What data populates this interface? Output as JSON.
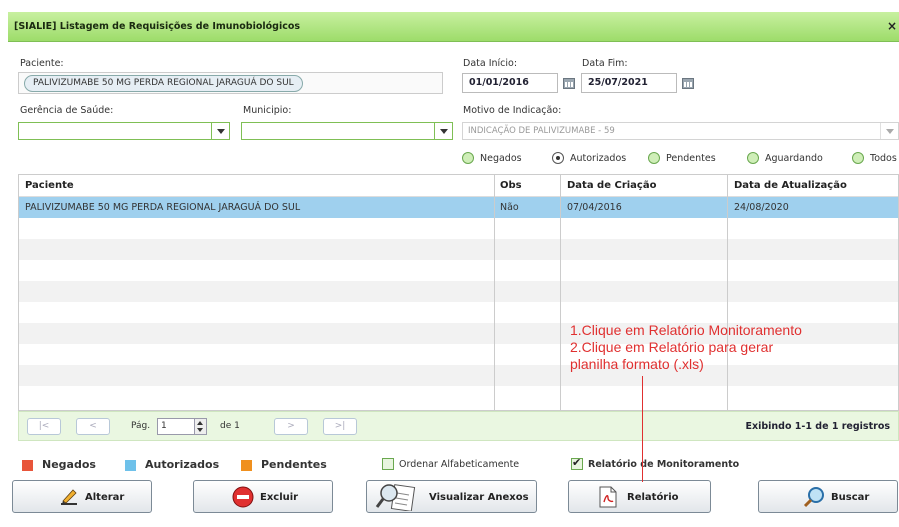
{
  "window": {
    "title": "[SIALIE] Listagem de Requisições de Imunobiológicos",
    "close_label": "×"
  },
  "filters": {
    "paciente_label": "Paciente:",
    "paciente_value": "PALIVIZUMABE 50 MG PERDA REGIONAL JARAGUÁ DO SUL",
    "data_inicio_label": "Data Início:",
    "data_inicio_value": "01/01/2016",
    "data_fim_label": "Data Fim:",
    "data_fim_value": "25/07/2021",
    "gerencia_label": "Gerência de Saúde:",
    "gerencia_value": "",
    "municipio_label": "Municipio:",
    "municipio_value": "",
    "motivo_label": "Motivo de Indicação:",
    "motivo_value": "INDICAÇÃO DE PALIVIZUMABE - 59"
  },
  "status_radios": [
    {
      "label": "Negados",
      "selected": false
    },
    {
      "label": "Autorizados",
      "selected": true
    },
    {
      "label": "Pendentes",
      "selected": false
    },
    {
      "label": "Aguardando",
      "selected": false
    },
    {
      "label": "Todos",
      "selected": false
    }
  ],
  "table": {
    "columns": [
      "Paciente",
      "Obs",
      "Data de Criação",
      "Data de Atualização"
    ],
    "rows": [
      [
        "PALIVIZUMABE 50 MG PERDA REGIONAL JARAGUÁ DO SUL",
        "Não",
        "07/04/2016",
        "24/08/2020"
      ]
    ]
  },
  "pager": {
    "first": "|<",
    "prev": "<",
    "next": ">",
    "last": ">|",
    "page_label": "Pág.",
    "page_value": "1",
    "of_label": "de 1",
    "count_text": "Exibindo 1-1 de 1 registros"
  },
  "legend": [
    {
      "label": "Negados",
      "color": "#e8553a"
    },
    {
      "label": "Autorizados",
      "color": "#6ec1ea"
    },
    {
      "label": "Pendentes",
      "color": "#f0901e"
    }
  ],
  "options": {
    "ordenar_label": "Ordenar Alfabeticamente",
    "ordenar_checked": false,
    "relatorio_monitoramento_label": "Relatório de Monitoramento",
    "relatorio_monitoramento_checked": true
  },
  "buttons": {
    "alterar": "Alterar",
    "excluir": "Excluir",
    "visualizar_anexos": "Visualizar Anexos",
    "relatorio": "Relatório",
    "buscar": "Buscar"
  },
  "annotation": {
    "line1": "1.Clique em Relatório Monitoramento",
    "line2": "2.Clique em Relatório para gerar",
    "line3": "planilha formato (.xls)"
  },
  "colors": {
    "accent_green": "#9ddc6a",
    "selected_row": "#9fd0ee",
    "annotation_red": "#e03030"
  }
}
